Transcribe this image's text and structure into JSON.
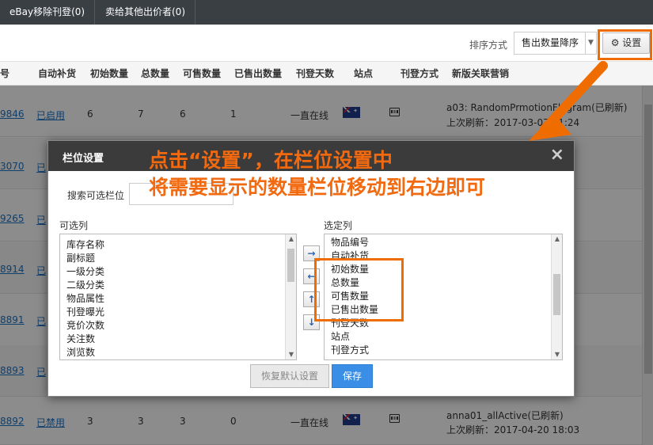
{
  "top_tabs": [
    "eBay移除刊登(0)",
    "卖给其他出价者(0)"
  ],
  "toolbar": {
    "sort_label": "排序方式",
    "sort_value": "售出数量降序",
    "settings_label": "设置",
    "settings_icon": "gear-icon"
  },
  "table": {
    "headers": [
      "号",
      "自动补货",
      "初始数量",
      "总数量",
      "可售数量",
      "已售出数量",
      "刊登天数",
      "站点",
      "刊登方式",
      "新版关联营销"
    ],
    "rows": [
      {
        "id": "9846",
        "auto": "已启用",
        "init": "6",
        "total": "7",
        "avail": "6",
        "sold": "1",
        "days": "一直在线",
        "promo": "a03: RandomPrmotionFlagram(已刷新)",
        "refresh": "上次刷新：2017-03-07 11:24"
      },
      {
        "id": "3070",
        "auto": "已"
      },
      {
        "id": "9265",
        "auto": "已"
      },
      {
        "id": "8914",
        "auto": "已"
      },
      {
        "id": "8891",
        "auto": "已"
      },
      {
        "id": "8893",
        "auto": "已"
      },
      {
        "id": "8892",
        "auto": "已禁用",
        "init": "3",
        "total": "3",
        "avail": "3",
        "sold": "0",
        "days": "一直在线",
        "promo": "anna01_allActive(已刷新)",
        "refresh": "上次刷新：2017-04-20 18:03"
      }
    ]
  },
  "modal": {
    "title": "栏位设置",
    "close_glyph": "×",
    "search_label": "搜索可选栏位",
    "search_value": "",
    "available_label": "可选列",
    "selected_label": "选定列",
    "available_items": [
      "库存名称",
      "副标题",
      "一级分类",
      "二级分类",
      "物品属性",
      "刊登曝光",
      "竞价次数",
      "关注数",
      "浏览数"
    ],
    "selected_items": [
      "物品编号",
      "自动补货",
      "初始数量",
      "总数量",
      "可售数量",
      "已售出数量",
      "刊登天数",
      "站点",
      "刊登方式"
    ],
    "move_buttons": [
      "→",
      "←",
      "↑",
      "↓"
    ],
    "reset_label": "恢复默认设置",
    "save_label": "保存"
  },
  "annotation": {
    "line1": "点击“设置”，在栏位设置中",
    "line2": "将需要显示的数量栏位移动到右边即可",
    "color": "#f26a10"
  }
}
